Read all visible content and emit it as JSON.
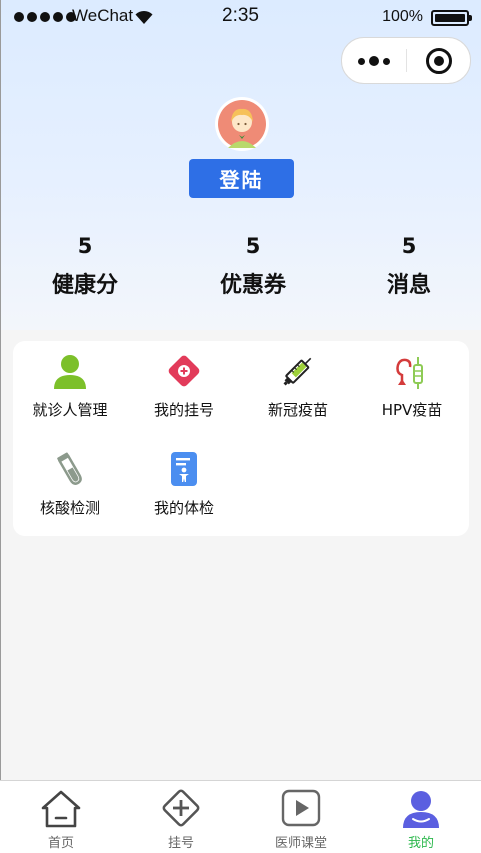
{
  "status_bar": {
    "carrier": "WeChat",
    "time": "2:35",
    "battery": "100%"
  },
  "header": {
    "login_label": "登陆"
  },
  "stats": [
    {
      "value": "5",
      "label": "健康分"
    },
    {
      "value": "5",
      "label": "优惠券"
    },
    {
      "value": "5",
      "label": "消息"
    }
  ],
  "menu": [
    {
      "label": "就诊人管理",
      "icon": "person-icon"
    },
    {
      "label": "我的挂号",
      "icon": "medical-cross-icon"
    },
    {
      "label": "新冠疫苗",
      "icon": "syringe-icon"
    },
    {
      "label": "HPV疫苗",
      "icon": "vaccine-icon"
    },
    {
      "label": "核酸检测",
      "icon": "test-tube-icon"
    },
    {
      "label": "我的体检",
      "icon": "checkup-report-icon"
    }
  ],
  "tabbar": [
    {
      "label": "首页",
      "icon": "home-icon"
    },
    {
      "label": "挂号",
      "icon": "register-icon"
    },
    {
      "label": "医师课堂",
      "icon": "play-icon"
    },
    {
      "label": "我的",
      "icon": "user-icon",
      "active": true
    }
  ],
  "colors": {
    "primary": "#2e6fe6",
    "active_tab": "#2db84d",
    "hero_bg": "#dcebff"
  }
}
